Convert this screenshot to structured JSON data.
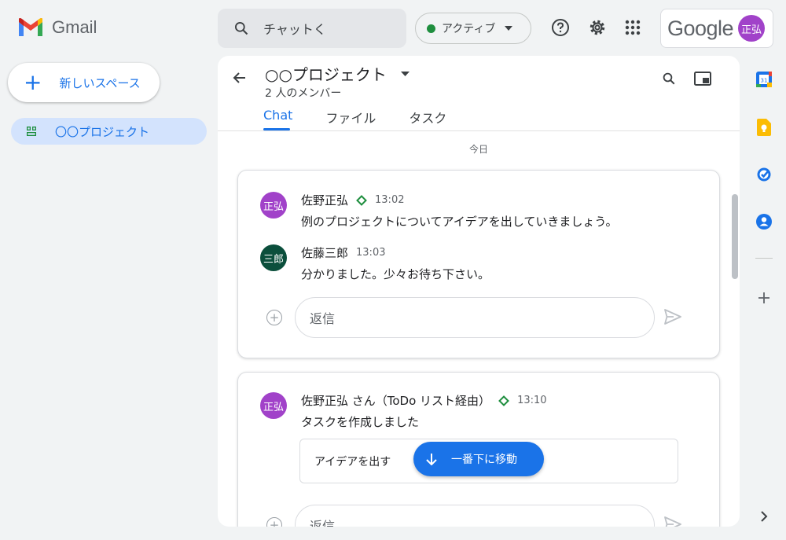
{
  "app": {
    "name": "Gmail"
  },
  "search": {
    "placeholder": "チャットく"
  },
  "status": {
    "label": "アクティブ",
    "color": "#1e8e3e"
  },
  "account": {
    "brand": "Google",
    "avatar_text": "正弘"
  },
  "nav": {
    "new_space": "新しいスペース",
    "spaces": [
      {
        "label": "〇〇プロジェクト",
        "selected": true
      }
    ]
  },
  "space": {
    "title": "○○プロジェクト",
    "members": "2 人のメンバー",
    "tabs": [
      "Chat",
      "ファイル",
      "タスク"
    ],
    "active_tab": "Chat"
  },
  "date_divider": "今日",
  "threads": [
    {
      "messages": [
        {
          "avatar": "正弘",
          "avatar_color": "#a142c9",
          "sender": "佐野正弘",
          "badge": "diamond-icon",
          "time": "13:02",
          "text": "例のプロジェクトについてアイデアを出していきましょう。"
        },
        {
          "avatar": "三郎",
          "avatar_color": "#0b4f3c",
          "sender": "佐藤三郎",
          "time": "13:03",
          "text": "分かりました。少々お待ち下さい。"
        }
      ],
      "reply_placeholder": "返信"
    },
    {
      "messages": [
        {
          "avatar": "正弘",
          "avatar_color": "#a142c9",
          "sender": "佐野正弘 さん（ToDo リスト経由）",
          "badge": "diamond-icon",
          "time": "13:10",
          "text": "タスクを作成しました"
        }
      ],
      "task": "アイデアを出す",
      "reply_placeholder": "返信"
    }
  ],
  "jump_button": "一番下に移動",
  "rail": [
    "calendar-icon",
    "keep-icon",
    "tasks-icon",
    "contacts-icon",
    "add-icon"
  ]
}
